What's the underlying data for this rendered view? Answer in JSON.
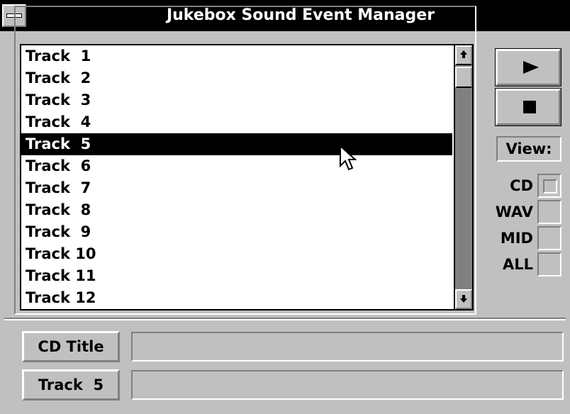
{
  "window": {
    "title": "Jukebox Sound Event Manager"
  },
  "tracklist": {
    "items": [
      "Track  1",
      "Track  2",
      "Track  3",
      "Track  4",
      "Track  5",
      "Track  6",
      "Track  7",
      "Track  8",
      "Track  9",
      "Track 10",
      "Track 11",
      "Track 12"
    ],
    "selected_index": 4,
    "scroll_up_icon": "arrow-up-icon",
    "scroll_down_icon": "arrow-down-icon"
  },
  "controls": {
    "play_icon": "play-icon",
    "stop_icon": "stop-icon",
    "view_label": "View:",
    "view_options": [
      {
        "label": "CD",
        "checked": true
      },
      {
        "label": "WAV",
        "checked": false
      },
      {
        "label": "MID",
        "checked": false
      },
      {
        "label": "ALL",
        "checked": false
      }
    ]
  },
  "info": {
    "cd_title_label": "CD Title",
    "cd_title_value": "",
    "track_label": "Track  5",
    "track_value": ""
  },
  "colors": {
    "face": "#c0c0c0",
    "titlebar": "#000000",
    "selection": "#000000",
    "scroll_track": "#808080"
  }
}
